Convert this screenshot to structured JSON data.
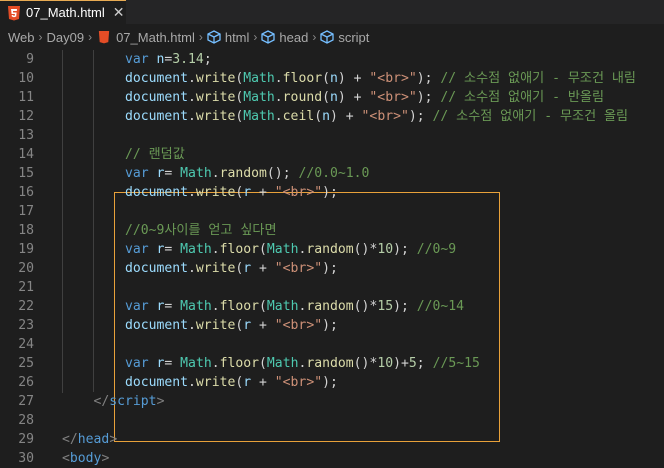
{
  "tab": {
    "label": "07_Math.html",
    "close": "✕"
  },
  "breadcrumb": {
    "items": [
      "Web",
      "Day09",
      "07_Math.html",
      "html",
      "head",
      "script"
    ]
  },
  "colors": {
    "tab_border": "#e8ab53",
    "highlight_box": "#e8a13a",
    "background": "#1e1e1e"
  },
  "lines": [
    {
      "n": "9",
      "indent": 8,
      "tokens": [
        [
          "kw",
          "var"
        ],
        [
          "d",
          " "
        ],
        [
          "var",
          "n"
        ],
        [
          "d",
          "="
        ],
        [
          "num",
          "3.14"
        ],
        [
          "d",
          ";"
        ]
      ]
    },
    {
      "n": "10",
      "indent": 8,
      "tokens": [
        [
          "var",
          "document"
        ],
        [
          "d",
          "."
        ],
        [
          "fn",
          "write"
        ],
        [
          "d",
          "("
        ],
        [
          "obj",
          "Math"
        ],
        [
          "d",
          "."
        ],
        [
          "fn",
          "floor"
        ],
        [
          "d",
          "("
        ],
        [
          "var",
          "n"
        ],
        [
          "d",
          ") + "
        ],
        [
          "str",
          "\"<br>\""
        ],
        [
          "d",
          "); "
        ],
        [
          "cmt",
          "// 소수점 없애기 - 무조건 내림"
        ]
      ]
    },
    {
      "n": "11",
      "indent": 8,
      "tokens": [
        [
          "var",
          "document"
        ],
        [
          "d",
          "."
        ],
        [
          "fn",
          "write"
        ],
        [
          "d",
          "("
        ],
        [
          "obj",
          "Math"
        ],
        [
          "d",
          "."
        ],
        [
          "fn",
          "round"
        ],
        [
          "d",
          "("
        ],
        [
          "var",
          "n"
        ],
        [
          "d",
          ") + "
        ],
        [
          "str",
          "\"<br>\""
        ],
        [
          "d",
          "); "
        ],
        [
          "cmt",
          "// 소수점 없애기 - 반올림"
        ]
      ]
    },
    {
      "n": "12",
      "indent": 8,
      "tokens": [
        [
          "var",
          "document"
        ],
        [
          "d",
          "."
        ],
        [
          "fn",
          "write"
        ],
        [
          "d",
          "("
        ],
        [
          "obj",
          "Math"
        ],
        [
          "d",
          "."
        ],
        [
          "fn",
          "ceil"
        ],
        [
          "d",
          "("
        ],
        [
          "var",
          "n"
        ],
        [
          "d",
          ") + "
        ],
        [
          "str",
          "\"<br>\""
        ],
        [
          "d",
          "); "
        ],
        [
          "cmt",
          "// 소수점 없애기 - 무조건 올림"
        ]
      ]
    },
    {
      "n": "13",
      "indent": 0,
      "tokens": []
    },
    {
      "n": "14",
      "indent": 8,
      "tokens": [
        [
          "cmt",
          "// 랜덤값"
        ]
      ]
    },
    {
      "n": "15",
      "indent": 8,
      "tokens": [
        [
          "kw",
          "var"
        ],
        [
          "d",
          " "
        ],
        [
          "var",
          "r"
        ],
        [
          "d",
          "= "
        ],
        [
          "obj",
          "Math"
        ],
        [
          "d",
          "."
        ],
        [
          "fn",
          "random"
        ],
        [
          "d",
          "(); "
        ],
        [
          "cmt",
          "//0.0~1.0"
        ]
      ]
    },
    {
      "n": "16",
      "indent": 8,
      "tokens": [
        [
          "var",
          "document"
        ],
        [
          "d",
          "."
        ],
        [
          "fn",
          "write"
        ],
        [
          "d",
          "("
        ],
        [
          "var",
          "r"
        ],
        [
          "d",
          " + "
        ],
        [
          "str",
          "\"<br>\""
        ],
        [
          "d",
          ");"
        ]
      ]
    },
    {
      "n": "17",
      "indent": 0,
      "tokens": []
    },
    {
      "n": "18",
      "indent": 8,
      "tokens": [
        [
          "cmt",
          "//0~9사이를 얻고 싶다면"
        ]
      ]
    },
    {
      "n": "19",
      "indent": 8,
      "tokens": [
        [
          "kw",
          "var"
        ],
        [
          "d",
          " "
        ],
        [
          "var",
          "r"
        ],
        [
          "d",
          "= "
        ],
        [
          "obj",
          "Math"
        ],
        [
          "d",
          "."
        ],
        [
          "fn",
          "floor"
        ],
        [
          "d",
          "("
        ],
        [
          "obj",
          "Math"
        ],
        [
          "d",
          "."
        ],
        [
          "fn",
          "random"
        ],
        [
          "d",
          "()*"
        ],
        [
          "num",
          "10"
        ],
        [
          "d",
          "); "
        ],
        [
          "cmt",
          "//0~9"
        ]
      ]
    },
    {
      "n": "20",
      "indent": 8,
      "tokens": [
        [
          "var",
          "document"
        ],
        [
          "d",
          "."
        ],
        [
          "fn",
          "write"
        ],
        [
          "d",
          "("
        ],
        [
          "var",
          "r"
        ],
        [
          "d",
          " + "
        ],
        [
          "str",
          "\"<br>\""
        ],
        [
          "d",
          ");"
        ]
      ]
    },
    {
      "n": "21",
      "indent": 0,
      "tokens": []
    },
    {
      "n": "22",
      "indent": 8,
      "tokens": [
        [
          "kw",
          "var"
        ],
        [
          "d",
          " "
        ],
        [
          "var",
          "r"
        ],
        [
          "d",
          "= "
        ],
        [
          "obj",
          "Math"
        ],
        [
          "d",
          "."
        ],
        [
          "fn",
          "floor"
        ],
        [
          "d",
          "("
        ],
        [
          "obj",
          "Math"
        ],
        [
          "d",
          "."
        ],
        [
          "fn",
          "random"
        ],
        [
          "d",
          "()*"
        ],
        [
          "num",
          "15"
        ],
        [
          "d",
          "); "
        ],
        [
          "cmt",
          "//0~14"
        ]
      ]
    },
    {
      "n": "23",
      "indent": 8,
      "tokens": [
        [
          "var",
          "document"
        ],
        [
          "d",
          "."
        ],
        [
          "fn",
          "write"
        ],
        [
          "d",
          "("
        ],
        [
          "var",
          "r"
        ],
        [
          "d",
          " + "
        ],
        [
          "str",
          "\"<br>\""
        ],
        [
          "d",
          ");"
        ]
      ]
    },
    {
      "n": "24",
      "indent": 0,
      "tokens": []
    },
    {
      "n": "25",
      "indent": 8,
      "tokens": [
        [
          "kw",
          "var"
        ],
        [
          "d",
          " "
        ],
        [
          "var",
          "r"
        ],
        [
          "d",
          "= "
        ],
        [
          "obj",
          "Math"
        ],
        [
          "d",
          "."
        ],
        [
          "fn",
          "floor"
        ],
        [
          "d",
          "("
        ],
        [
          "obj",
          "Math"
        ],
        [
          "d",
          "."
        ],
        [
          "fn",
          "random"
        ],
        [
          "d",
          "()*"
        ],
        [
          "num",
          "10"
        ],
        [
          "d",
          ")+"
        ],
        [
          "num",
          "5"
        ],
        [
          "d",
          "; "
        ],
        [
          "cmt",
          "//5~15"
        ]
      ]
    },
    {
      "n": "26",
      "indent": 8,
      "tokens": [
        [
          "var",
          "document"
        ],
        [
          "d",
          "."
        ],
        [
          "fn",
          "write"
        ],
        [
          "d",
          "("
        ],
        [
          "var",
          "r"
        ],
        [
          "d",
          " + "
        ],
        [
          "str",
          "\"<br>\""
        ],
        [
          "d",
          ");"
        ]
      ]
    },
    {
      "n": "27",
      "indent": 4,
      "tokens": [
        [
          "punc",
          "</"
        ],
        [
          "tag",
          "script"
        ],
        [
          "punc",
          ">"
        ]
      ]
    },
    {
      "n": "28",
      "indent": 0,
      "tokens": []
    },
    {
      "n": "29",
      "indent": 0,
      "tokens": [
        [
          "punc",
          "</"
        ],
        [
          "tag",
          "head"
        ],
        [
          "punc",
          ">"
        ]
      ]
    },
    {
      "n": "30",
      "indent": 0,
      "tokens": [
        [
          "punc",
          "<"
        ],
        [
          "tag",
          "body"
        ],
        [
          "punc",
          ">"
        ]
      ]
    }
  ]
}
